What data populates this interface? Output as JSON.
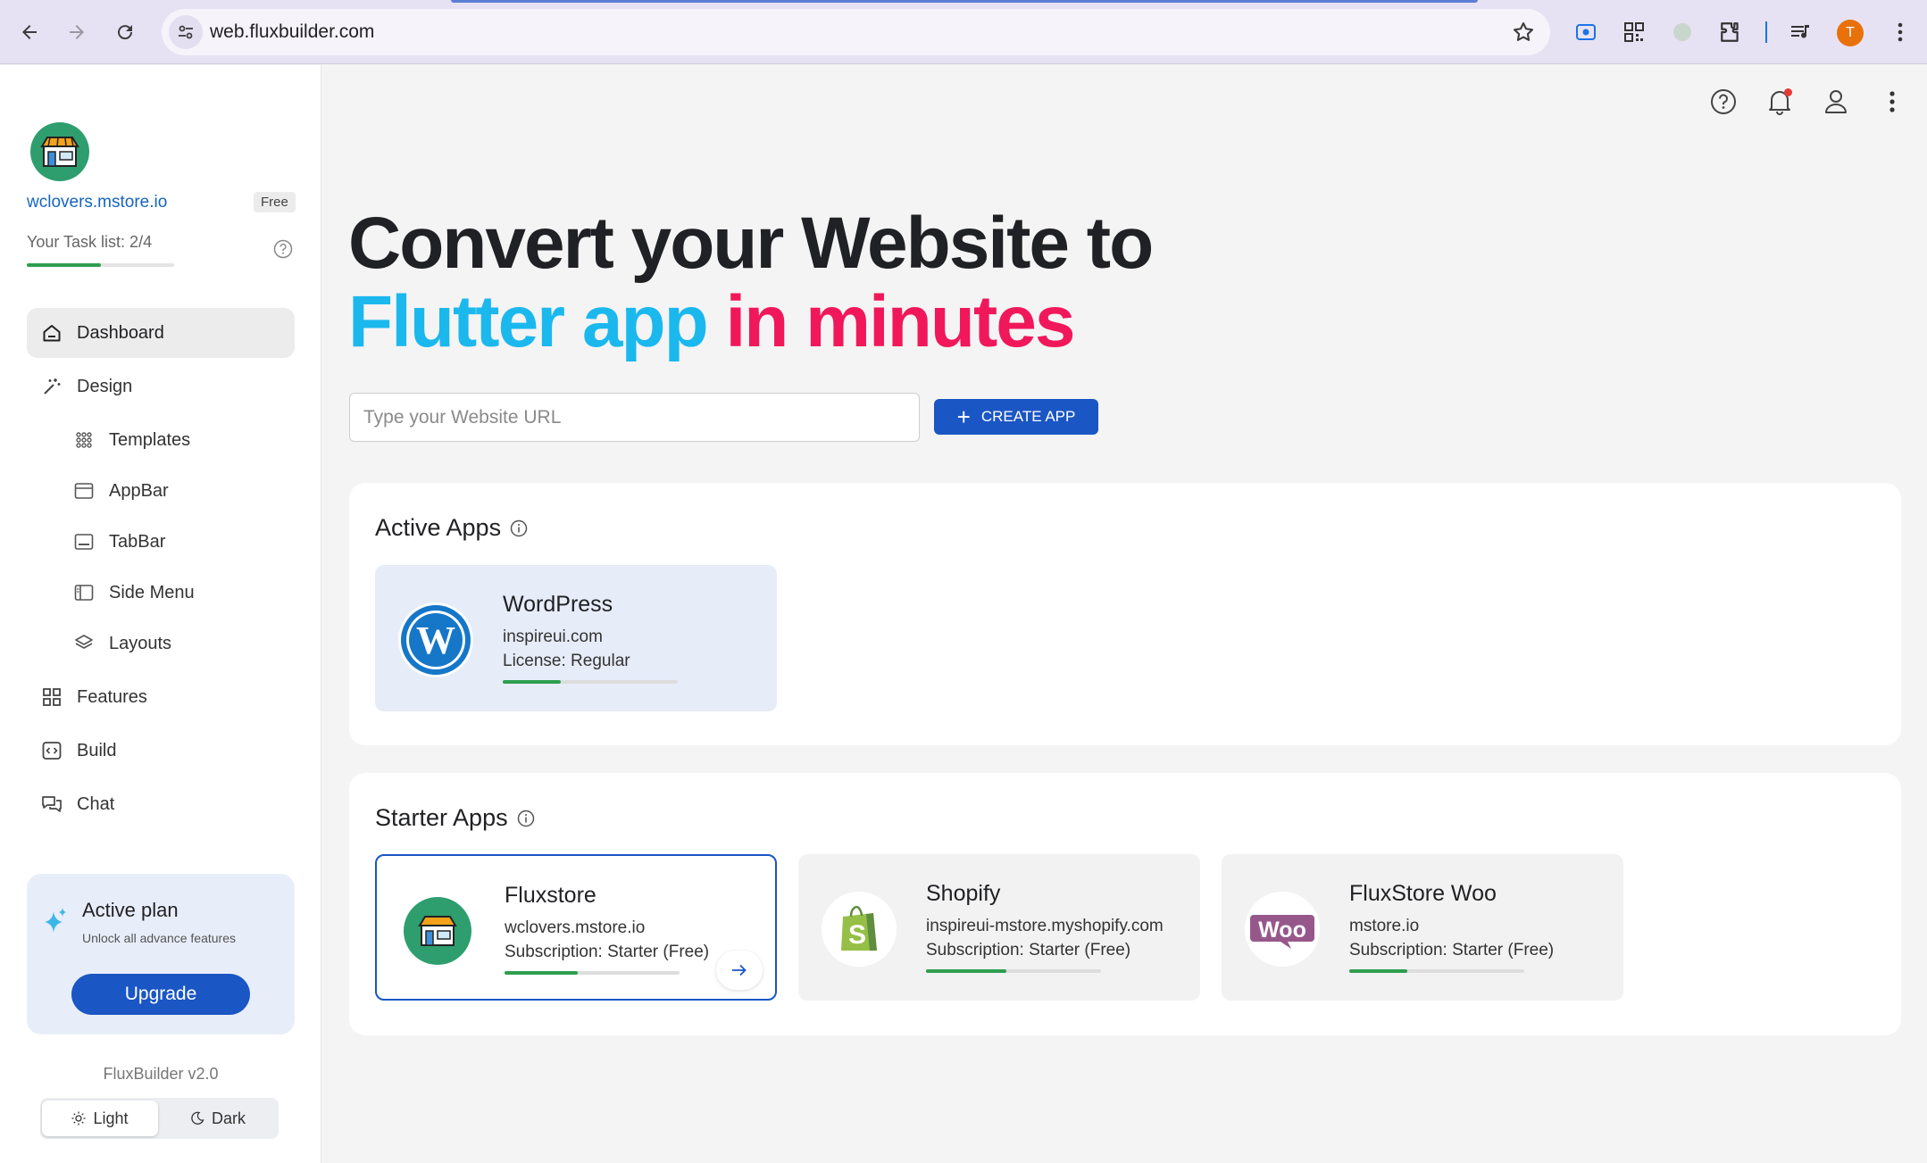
{
  "browser": {
    "url": "web.fluxbuilder.com",
    "profile_initial": "T"
  },
  "sidebar": {
    "site_name": "wclovers.mstore.io",
    "plan_badge": "Free",
    "task_list_label": "Your Task list: 2/4",
    "task_progress": 0.5,
    "menu": [
      {
        "label": "Dashboard",
        "icon": "home-icon",
        "active": true
      },
      {
        "label": "Design",
        "icon": "magic-wand-icon"
      },
      {
        "label": "Templates",
        "icon": "grid-dots-icon"
      },
      {
        "label": "AppBar",
        "icon": "appbar-icon"
      },
      {
        "label": "TabBar",
        "icon": "tabbar-icon"
      },
      {
        "label": "Side Menu",
        "icon": "side-menu-icon"
      },
      {
        "label": "Layouts",
        "icon": "layers-icon"
      },
      {
        "label": "Features",
        "icon": "features-grid-icon"
      },
      {
        "label": "Build",
        "icon": "code-icon"
      },
      {
        "label": "Chat",
        "icon": "chat-icon"
      }
    ],
    "plan_card": {
      "title": "Active plan",
      "subtitle": "Unlock all advance features",
      "button": "Upgrade"
    },
    "version": "FluxBuilder v2.0",
    "theme": {
      "light": "Light",
      "dark": "Dark",
      "selected": "light"
    }
  },
  "hero": {
    "line1": "Convert your Website to",
    "line2_blue": "Flutter app",
    "line2_pink": "in minutes"
  },
  "create": {
    "placeholder": "Type your Website URL",
    "button": "CREATE APP"
  },
  "active_apps": {
    "title": "Active Apps",
    "items": [
      {
        "name": "WordPress",
        "domain": "inspireui.com",
        "detail": "License: Regular",
        "progress": 0.33
      }
    ]
  },
  "starter_apps": {
    "title": "Starter Apps",
    "items": [
      {
        "name": "Fluxstore",
        "domain": "wclovers.mstore.io",
        "detail": "Subscription: Starter (Free)",
        "progress": 0.42
      },
      {
        "name": "Shopify",
        "domain": "inspireui-mstore.myshopify.com",
        "detail": "Subscription: Starter (Free)",
        "progress": 0.46
      },
      {
        "name": "FluxStore Woo",
        "domain": "mstore.io",
        "detail": "Subscription: Starter (Free)",
        "progress": 0.33
      }
    ]
  },
  "colors": {
    "accent": "#1a56c4",
    "hero_blue": "#1bb8ee",
    "hero_pink": "#f0185b",
    "progress": "#2e9e4e"
  }
}
